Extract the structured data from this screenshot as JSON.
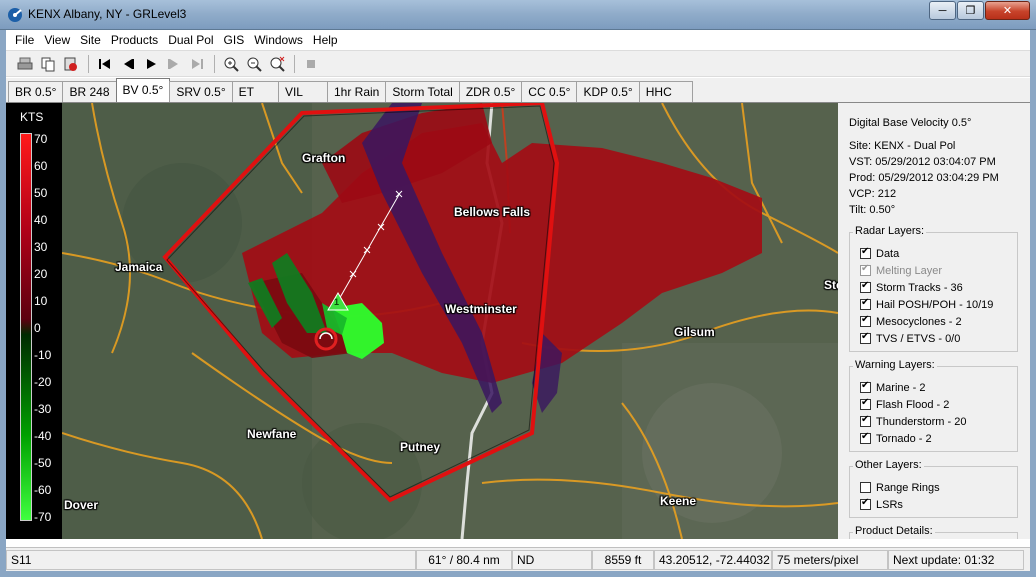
{
  "window": {
    "title": "KENX Albany, NY - GRLevel3"
  },
  "menu": [
    "File",
    "View",
    "Site",
    "Products",
    "Dual Pol",
    "GIS",
    "Windows",
    "Help"
  ],
  "tabs": [
    {
      "label": "BR 0.5°"
    },
    {
      "label": "BR 248"
    },
    {
      "label": "BV 0.5°",
      "active": true
    },
    {
      "label": "SRV 0.5°"
    },
    {
      "label": "ET"
    },
    {
      "label": "VIL"
    },
    {
      "label": "1hr Rain"
    },
    {
      "label": "Storm Total"
    },
    {
      "label": "ZDR 0.5°"
    },
    {
      "label": "CC 0.5°"
    },
    {
      "label": "KDP 0.5°"
    },
    {
      "label": "HHC"
    }
  ],
  "legend": {
    "unit": "KTS",
    "ticks": [
      "70",
      "60",
      "50",
      "40",
      "30",
      "20",
      "10",
      "0",
      "-10",
      "-20",
      "-30",
      "-40",
      "-50",
      "-60",
      "-70"
    ]
  },
  "map": {
    "places": [
      {
        "name": "Grafton"
      },
      {
        "name": "Bellows Falls"
      },
      {
        "name": "Jamaica"
      },
      {
        "name": "Westminster"
      },
      {
        "name": "Gilsum"
      },
      {
        "name": "Newfane"
      },
      {
        "name": "Putney"
      },
      {
        "name": "Keene"
      },
      {
        "name": "Dover"
      },
      {
        "name": "Sto"
      }
    ],
    "storm_marker": "1"
  },
  "product": {
    "title": "Digital Base Velocity 0.5°",
    "site": "Site:  KENX - Dual Pol",
    "vst": "VST:  05/29/2012  03:04:07 PM",
    "prod": "Prod: 05/29/2012  03:04:29 PM",
    "vcp": "VCP:  212",
    "tilt": "Tilt:   0.50°"
  },
  "radar_layers": {
    "title": "Radar Layers:",
    "items": [
      {
        "label": "Data",
        "checked": true
      },
      {
        "label": "Melting Layer",
        "checked": true,
        "disabled": true
      },
      {
        "label": "Storm Tracks - 36",
        "checked": true
      },
      {
        "label": "Hail POSH/POH - 10/19",
        "checked": true
      },
      {
        "label": "Mesocyclones - 2",
        "checked": true
      },
      {
        "label": "TVS / ETVS - 0/0",
        "checked": true
      }
    ]
  },
  "warning_layers": {
    "title": "Warning Layers:",
    "items": [
      {
        "label": "Marine - 2",
        "checked": true
      },
      {
        "label": "Flash Flood - 2",
        "checked": true
      },
      {
        "label": "Thunderstorm - 20",
        "checked": true
      },
      {
        "label": "Tornado - 2",
        "checked": true
      }
    ]
  },
  "other_layers": {
    "title": "Other Layers:",
    "items": [
      {
        "label": "Range Rings",
        "checked": false
      },
      {
        "label": "LSRs",
        "checked": true
      }
    ]
  },
  "product_details": {
    "title": "Product Details:"
  },
  "status": {
    "id": "S11",
    "azimuth": "61° / 80.4 nm",
    "value": "ND",
    "height": "8559 ft",
    "coords": "43.20512, -72.44032",
    "resolution": "75 meters/pixel",
    "next_update": "Next update: 01:32"
  },
  "colors": {
    "warning": "#e01010",
    "road": "#e8a020",
    "river": "#ffffff"
  }
}
